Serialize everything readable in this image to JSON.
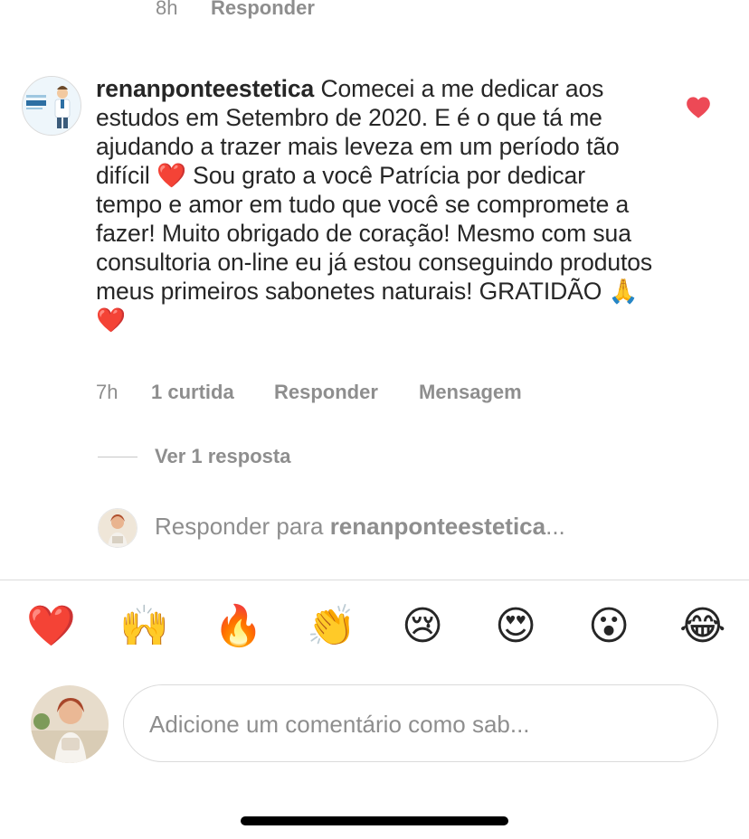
{
  "previous_comment": {
    "time": "8h",
    "reply_label": "Responder"
  },
  "comment": {
    "username": "renanponteestetica",
    "text_parts": [
      " Comecei a me dedicar aos estudos em Setembro de 2020. E é o que tá me ajudando a trazer mais leveza em um período tão difícil ",
      " Sou grato a você Patrícia por dedicar tempo e amor em tudo que você se compromete a fazer! Muito obrigado de coração! Mesmo com sua consultoria on-line eu já estou conseguindo produtos meus primeiros sabonetes naturais! GRATIDÃO ",
      " "
    ],
    "emoji_heart": "❤️",
    "emoji_pray": "🙏",
    "time": "7h",
    "likes": "1 curtida",
    "reply_label": "Responder",
    "message_label": "Mensagem",
    "liked": true,
    "like_color": "#ed4956"
  },
  "view_replies": "Ver 1 resposta",
  "reply_to": {
    "prefix": "Responder para ",
    "username": "renanponteestetica",
    "suffix": "..."
  },
  "emoji_bar": [
    {
      "name": "heart",
      "glyph": "❤️"
    },
    {
      "name": "raising-hands",
      "glyph": "🙌"
    },
    {
      "name": "fire",
      "glyph": "🔥"
    },
    {
      "name": "clapping-hands",
      "glyph": "👏"
    },
    {
      "name": "crying-face",
      "glyph": "😢"
    },
    {
      "name": "heart-eyes",
      "glyph": "😍"
    },
    {
      "name": "surprised-face",
      "glyph": "😮"
    },
    {
      "name": "laughing-face",
      "glyph": "😂"
    }
  ],
  "composer": {
    "placeholder": "Adicione um comentário como sab..."
  }
}
